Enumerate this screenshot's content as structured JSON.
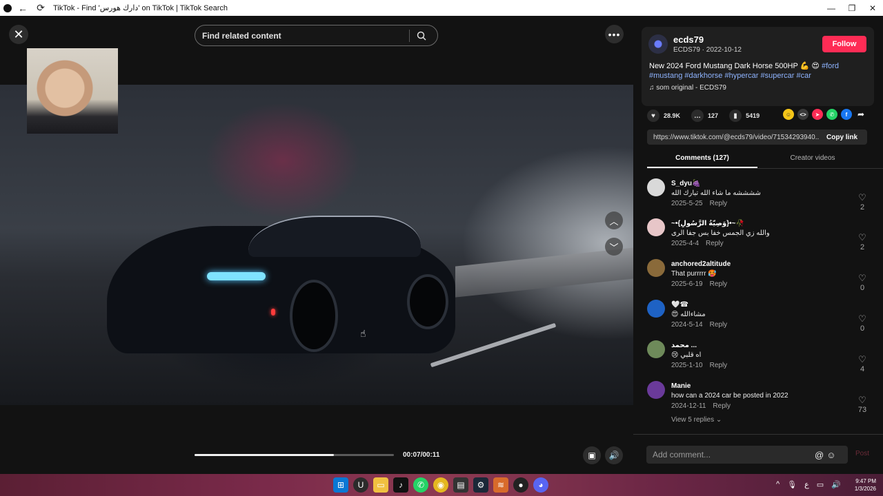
{
  "browser": {
    "title": "TikTok - Find 'دارك هورس' on TikTok | TikTok Search",
    "back_icon": "arrow-left-icon",
    "reload_icon": "reload-icon",
    "controls": [
      "—",
      "❐",
      "✕"
    ]
  },
  "player": {
    "search_placeholder": "Find related content",
    "time": "00:07/00:11",
    "progress": 0.7,
    "more_label": "•••"
  },
  "post": {
    "author_name": "ecds79",
    "author_meta": "ECDS79 · 2022-10-12",
    "follow_label": "Follow",
    "desc_text": "New 2024 Ford Mustang Dark Horse 500HP 💪 😍 ",
    "hashtags": [
      "#ford",
      "#mustang",
      "#darkhorse",
      "#hypercar",
      "#supercar",
      "#car"
    ],
    "sound": "som original - ECDS79",
    "likes": "28.9K",
    "comments_count": "127",
    "saves": "5419",
    "link": "https://www.tiktok.com/@ecds79/video/71534293940...",
    "copy_label": "Copy link"
  },
  "tabs": {
    "comments": "Comments (127)",
    "creator": "Creator videos"
  },
  "comments": [
    {
      "user": "S_dyu🍇",
      "text": "ششششه ما شاء الله تبارك الله",
      "date": "2025-5-25",
      "reply": "Reply",
      "likes": "2",
      "avatar_color": "#d9d9d9"
    },
    {
      "user": "~•{وَصِيّةُ الرَّسُولِ}•~🥀",
      "text": "والله زي الجمس خفا بس جفا الرى",
      "date": "2025-4-4",
      "reply": "Reply",
      "likes": "2",
      "avatar_color": "#e7c6c8"
    },
    {
      "user": "anchored2altitude",
      "text": "That purrrrr 🥵",
      "date": "2025-6-19",
      "reply": "Reply",
      "likes": "0",
      "avatar_color": "#8a6a3a"
    },
    {
      "user": "🤍☎",
      "text": "😍 مشاءالله",
      "date": "2024-5-14",
      "reply": "Reply",
      "likes": "0",
      "avatar_color": "#1e62c4"
    },
    {
      "user": "محمد ...",
      "text": "😢 اه قلبي",
      "date": "2025-1-10",
      "reply": "Reply",
      "likes": "4",
      "avatar_color": "#6e8a5a"
    },
    {
      "user": "Manie",
      "text": "how can a 2024 car be posted in 2022",
      "date": "2024-12-11",
      "reply": "Reply",
      "likes": "73",
      "avatar_color": "#6a3a9a"
    }
  ],
  "view_replies": "View 5 replies ⌄",
  "composer": {
    "placeholder": "Add comment...",
    "post_label": "Post"
  },
  "taskbar": {
    "time": "9:47 PM",
    "date": "1/3/2026",
    "lang": "ع"
  }
}
